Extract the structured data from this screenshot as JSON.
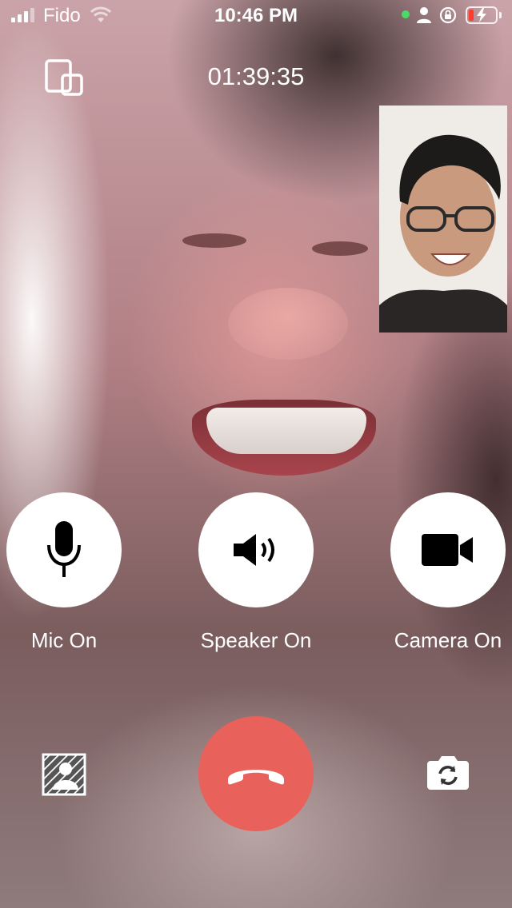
{
  "status_bar": {
    "carrier": "Fido",
    "time": "10:46 PM",
    "battery_color": "#ff3b30"
  },
  "call": {
    "duration": "01:39:35",
    "switch_view_icon": "switch-view-icon"
  },
  "controls": {
    "mic_label": "Mic On",
    "speaker_label": "Speaker On",
    "camera_label": "Camera On",
    "mic_icon": "microphone-icon",
    "speaker_icon": "speaker-icon",
    "camera_icon": "video-camera-icon"
  },
  "bottom_bar": {
    "blur_icon": "background-blur-icon",
    "hangup_icon": "phone-hangup-icon",
    "flip_icon": "flip-camera-icon",
    "hangup_color": "#e8615a"
  }
}
